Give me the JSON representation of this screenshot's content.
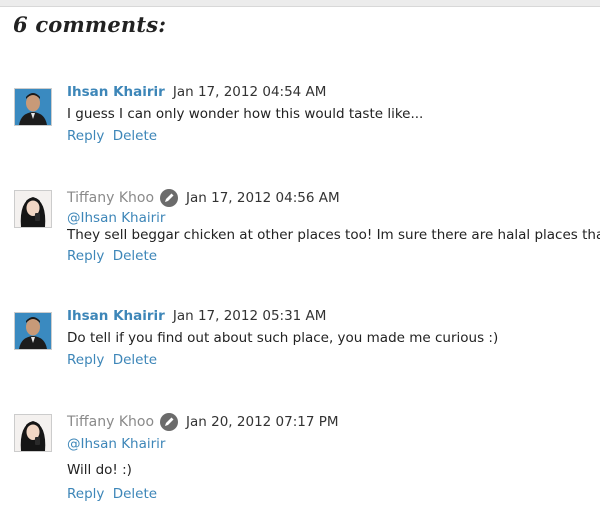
{
  "heading": "6 comments:",
  "comments": [
    {
      "author": "Ihsan Khairir",
      "timestamp": "Jan 17, 2012 04:54 AM",
      "mention": "",
      "text": "I guess I can only wonder how this would taste like...",
      "reply_label": "Reply",
      "delete_label": "Delete"
    },
    {
      "author": "Tiffany Khoo",
      "timestamp": "Jan 17, 2012 04:56 AM",
      "mention": "@Ihsan Khairir",
      "text": "They sell beggar chicken at other places too! Im sure there are halal places that do it!",
      "reply_label": "Reply",
      "delete_label": "Delete"
    },
    {
      "author": "Ihsan Khairir",
      "timestamp": "Jan 17, 2012 05:31 AM",
      "mention": "",
      "text": "Do tell if you find out about such place, you made me curious :)",
      "reply_label": "Reply",
      "delete_label": "Delete"
    },
    {
      "author": "Tiffany Khoo",
      "timestamp": "Jan 20, 2012 07:17 PM",
      "mention": "@Ihsan Khairir",
      "text": "Will do! :)",
      "reply_label": "Reply",
      "delete_label": "Delete"
    }
  ]
}
